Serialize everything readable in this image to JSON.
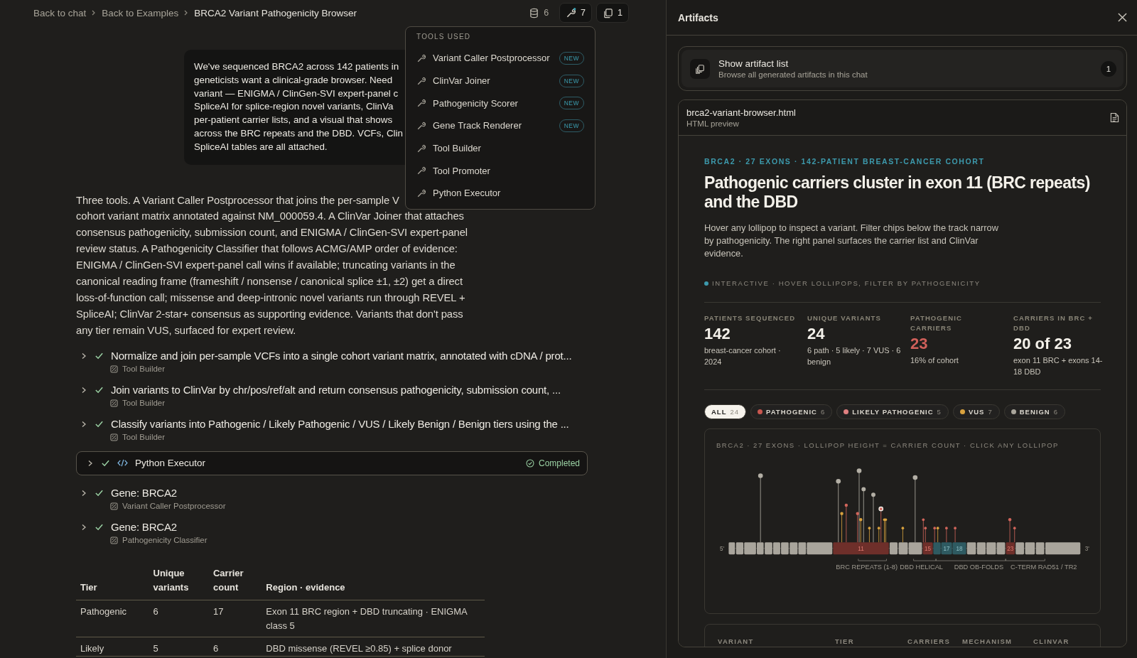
{
  "breadcrumb": [
    {
      "label": "Back to chat",
      "kind": "link"
    },
    {
      "label": "Back to Examples",
      "kind": "link"
    },
    {
      "label": "BRCA2 Variant Pathogenicity Browser",
      "kind": "current"
    }
  ],
  "toolbar": [
    {
      "kind": "database",
      "count": "6",
      "selected": false
    },
    {
      "kind": "tools",
      "count": "7",
      "selected": true
    },
    {
      "kind": "artifacts",
      "count": "1",
      "selected": true
    }
  ],
  "tools_menu": {
    "title": "TOOLS USED",
    "items": [
      {
        "name": "Variant Caller Postprocessor",
        "badge": "NEW"
      },
      {
        "name": "ClinVar Joiner",
        "badge": "NEW"
      },
      {
        "name": "Pathogenicity Scorer",
        "badge": "NEW"
      },
      {
        "name": "Gene Track Renderer",
        "badge": "NEW"
      },
      {
        "name": "Tool Builder"
      },
      {
        "name": "Tool Promoter"
      },
      {
        "name": "Python Executor"
      }
    ]
  },
  "user_message": {
    "lines": [
      "We've sequenced BRCA2 across 142 patients in",
      "geneticists want a clinical-grade browser. Need",
      "variant — ENIGMA / ClinGen-SVI expert-panel c",
      "SpliceAI for splice-region novel variants, ClinVa",
      "per-patient carrier lists, and a visual that shows",
      "across the BRC repeats and the DBD. VCFs, Clin",
      "SpliceAI tables are all attached."
    ]
  },
  "response": {
    "lines": [
      "Three tools. A Variant Caller Postprocessor that joins the per-sample V",
      "cohort variant matrix annotated against NM_000059.4. A ClinVar Joiner that attaches",
      "consensus pathogenicity, submission count, and ENIGMA / ClinGen-SVI expert-panel",
      "review status. A Pathogenicity Classifier that follows ACMG/AMP order of evidence:",
      "ENIGMA / ClinGen-SVI expert-panel call wins if available; truncating variants in the",
      "canonical reading frame (frameshift / nonsense / canonical splice ±1, ±2) get a direct",
      "loss-of-function call; missense and deep-intronic novel variants run through REVEL +",
      "SpliceAI; ClinVar 2-star+ consensus as supporting evidence. Variants that don't pass",
      "any tier remain VUS, surfaced for expert review."
    ]
  },
  "steps": [
    {
      "kind": "task",
      "title": "Normalize and join per-sample VCFs into a single cohort variant matrix, annotated with cDNA / prot...",
      "tool": "Tool Builder",
      "expanded": false,
      "done": true
    },
    {
      "kind": "task",
      "title": "Join variants to ClinVar by chr/pos/ref/alt and return consensus pathogenicity, submission count, ...",
      "tool": "Tool Builder",
      "expanded": false,
      "done": true
    },
    {
      "kind": "task",
      "title": "Classify variants into Pathogenic / Likely Pathogenic / VUS / Likely Benign / Benign tiers using the ...",
      "tool": "Tool Builder",
      "expanded": false,
      "done": true
    },
    {
      "kind": "executor",
      "title": "Python Executor",
      "status": "Completed",
      "expanded": false,
      "done": true
    },
    {
      "kind": "task",
      "title": "Gene: BRCA2",
      "tool": "Variant Caller Postprocessor",
      "expanded": false,
      "done": true
    },
    {
      "kind": "task",
      "title": "Gene: BRCA2",
      "tool": "Pathogenicity Classifier",
      "expanded": false,
      "done": true
    }
  ],
  "summary_table": {
    "columns": [
      "Tier",
      "Unique variants",
      "Carrier count",
      "Region · evidence"
    ],
    "rows": [
      [
        "Pathogenic",
        "6",
        "17",
        "Exon 11 BRC region + DBD truncating · ENIGMA class 5"
      ],
      [
        "Likely",
        "5",
        "6",
        "DBD missense (REVEL ≥0.85) + splice donor"
      ]
    ]
  },
  "artifacts_panel": {
    "title": "Artifacts",
    "list_card": {
      "title": "Show artifact list",
      "subtitle": "Browse all generated artifacts in this chat",
      "count": "1"
    },
    "preview": {
      "filename": "brca2-variant-browser.html",
      "subtitle": "HTML preview",
      "eyebrow": "BRCA2 · 27 EXONS · 142-PATIENT BREAST-CANCER COHORT",
      "heading": "Pathogenic carriers cluster in exon 11 (BRC repeats) and the DBD",
      "description": "Hover any lollipop to inspect a variant. Filter chips below the track narrow by pathogenicity. The right panel surfaces the carrier list and ClinVar evidence.",
      "hint": "INTERACTIVE · HOVER LOLLIPOPS, FILTER BY PATHOGENICITY",
      "stats": [
        {
          "label": "PATIENTS SEQUENCED",
          "value": "142",
          "note": "breast-cancer cohort · 2024",
          "alert": false
        },
        {
          "label": "UNIQUE VARIANTS",
          "value": "24",
          "note": "6 path · 5 likely · 7 VUS · 6 benign",
          "alert": false
        },
        {
          "label": "PATHOGENIC CARRIERS",
          "value": "23",
          "note": "16% of cohort",
          "alert": true
        },
        {
          "label": "CARRIERS IN BRC + DBD",
          "value": "20 of 23",
          "note": "exon 11 BRC + exons 14-18 DBD",
          "alert": false
        }
      ],
      "filters": [
        {
          "label": "ALL",
          "count": "24",
          "selected": true
        },
        {
          "label": "PATHOGENIC",
          "count": "6",
          "selected": false,
          "color": "#c9574f"
        },
        {
          "label": "LIKELY PATHOGENIC",
          "count": "5",
          "selected": false,
          "color": "#e08080"
        },
        {
          "label": "VUS",
          "count": "7",
          "selected": false,
          "color": "#d9a23e"
        },
        {
          "label": "BENIGN",
          "count": "6",
          "selected": false,
          "color": "#a9a59b"
        }
      ],
      "track": {
        "title": "BRCA2 · 27 EXONS · LOLLIPOP HEIGHT = CARRIER COUNT · CLICK ANY LOLLIPOP",
        "five_prime": "5'",
        "three_prime": "3'",
        "highlighted_exons": [
          {
            "label": "11",
            "kind": "hit"
          },
          {
            "label": "15",
            "kind": "hit"
          },
          {
            "label": "17",
            "kind": "domain"
          },
          {
            "label": "18",
            "kind": "domain"
          },
          {
            "label": "23",
            "kind": "hit"
          }
        ],
        "regions": [
          "BRC REPEATS (1-8)",
          "DBD HELICAL",
          "DBD OB-FOLDS",
          "C-TERM RAD51 / TR2"
        ]
      },
      "variant_table": {
        "columns": [
          "VARIANT",
          "TIER",
          "CARRIERS",
          "MECHANISM",
          "CLINVAR"
        ]
      }
    }
  }
}
